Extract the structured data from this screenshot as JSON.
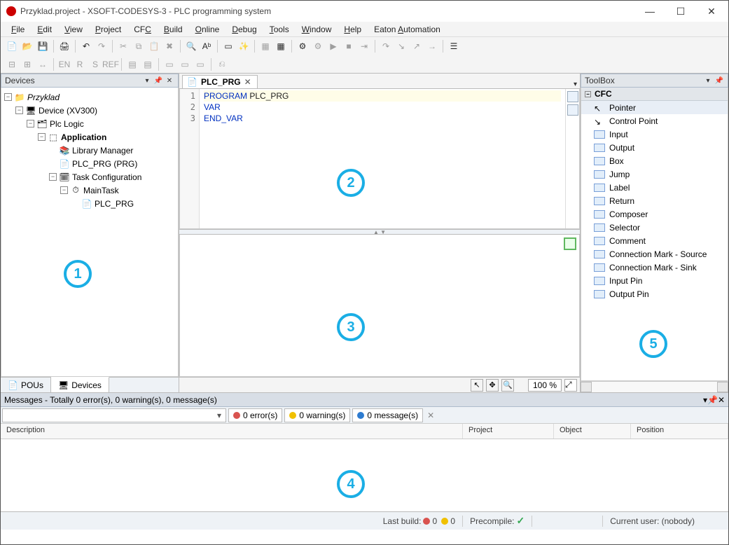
{
  "window": {
    "title": "Przyklad.project - XSOFT-CODESYS-3 - PLC programming system"
  },
  "menus": [
    "File",
    "Edit",
    "View",
    "Project",
    "CFC",
    "Build",
    "Online",
    "Debug",
    "Tools",
    "Window",
    "Help",
    "Eaton Automation"
  ],
  "devices_panel": {
    "title": "Devices",
    "tree": {
      "root": "Przyklad",
      "device": "Device (XV300)",
      "plc_logic": "Plc Logic",
      "application": "Application",
      "library_manager": "Library Manager",
      "plc_prg": "PLC_PRG (PRG)",
      "task_config": "Task Configuration",
      "main_task": "MainTask",
      "task_pou": "PLC_PRG"
    },
    "tabs": {
      "pous": "POUs",
      "devices": "Devices"
    }
  },
  "editor": {
    "tab_label": "PLC_PRG",
    "code_lines": [
      "PROGRAM PLC_PRG",
      "VAR",
      "END_VAR"
    ]
  },
  "body_footer": {
    "zoom": "100 %"
  },
  "toolbox": {
    "title": "ToolBox",
    "group": "CFC",
    "items": [
      "Pointer",
      "Control Point",
      "Input",
      "Output",
      "Box",
      "Jump",
      "Label",
      "Return",
      "Composer",
      "Selector",
      "Comment",
      "Connection Mark - Source",
      "Connection Mark - Sink",
      "Input Pin",
      "Output Pin"
    ]
  },
  "messages": {
    "header": "Messages - Totally 0 error(s), 0 warning(s), 0 message(s)",
    "errors": "0 error(s)",
    "warnings": "0 warning(s)",
    "msgs": "0 message(s)",
    "columns": {
      "description": "Description",
      "project": "Project",
      "object": "Object",
      "position": "Position"
    }
  },
  "status": {
    "last_build_label": "Last build:",
    "errors": "0",
    "warnings": "0",
    "precompile": "Precompile:",
    "user": "Current user: (nobody)"
  },
  "annotations": {
    "a1": "1",
    "a2": "2",
    "a3": "3",
    "a4": "4",
    "a5": "5"
  }
}
